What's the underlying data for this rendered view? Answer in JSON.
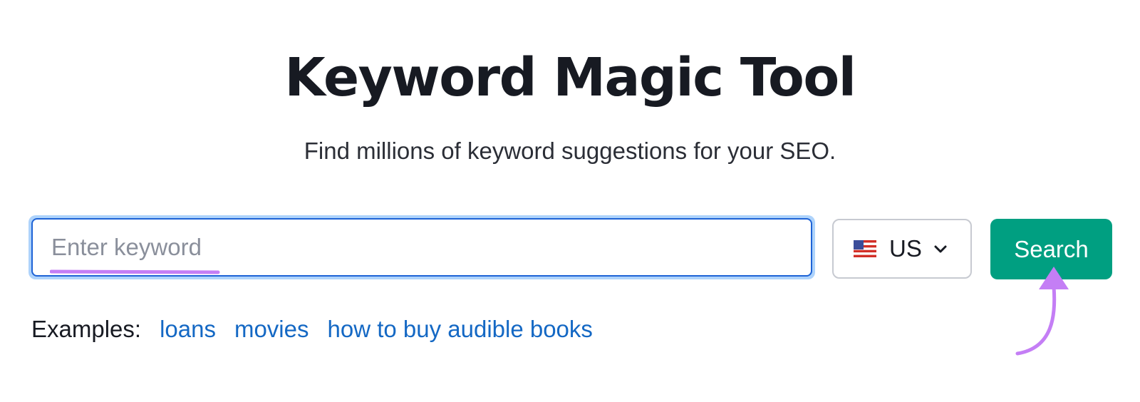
{
  "header": {
    "title": "Keyword Magic Tool",
    "subtitle": "Find millions of keyword suggestions for your SEO."
  },
  "search": {
    "value": "",
    "placeholder": "Enter keyword",
    "button_label": "Search"
  },
  "country": {
    "selected": "US",
    "icon": "us-flag-icon",
    "dropdown_icon": "chevron-down-icon"
  },
  "examples": {
    "label": "Examples:",
    "items": [
      "loans",
      "movies",
      "how to buy audible books"
    ]
  },
  "annotations": {
    "underline_icon": "highlight-underline",
    "arrow_icon": "pointer-arrow-icon"
  },
  "colors": {
    "title_text": "#171a22",
    "input_border": "#1e63d6",
    "input_focus_ring": "#aed3fb",
    "button_bg": "#009f81",
    "link": "#1468c4",
    "annotation": "#c47ef5"
  }
}
